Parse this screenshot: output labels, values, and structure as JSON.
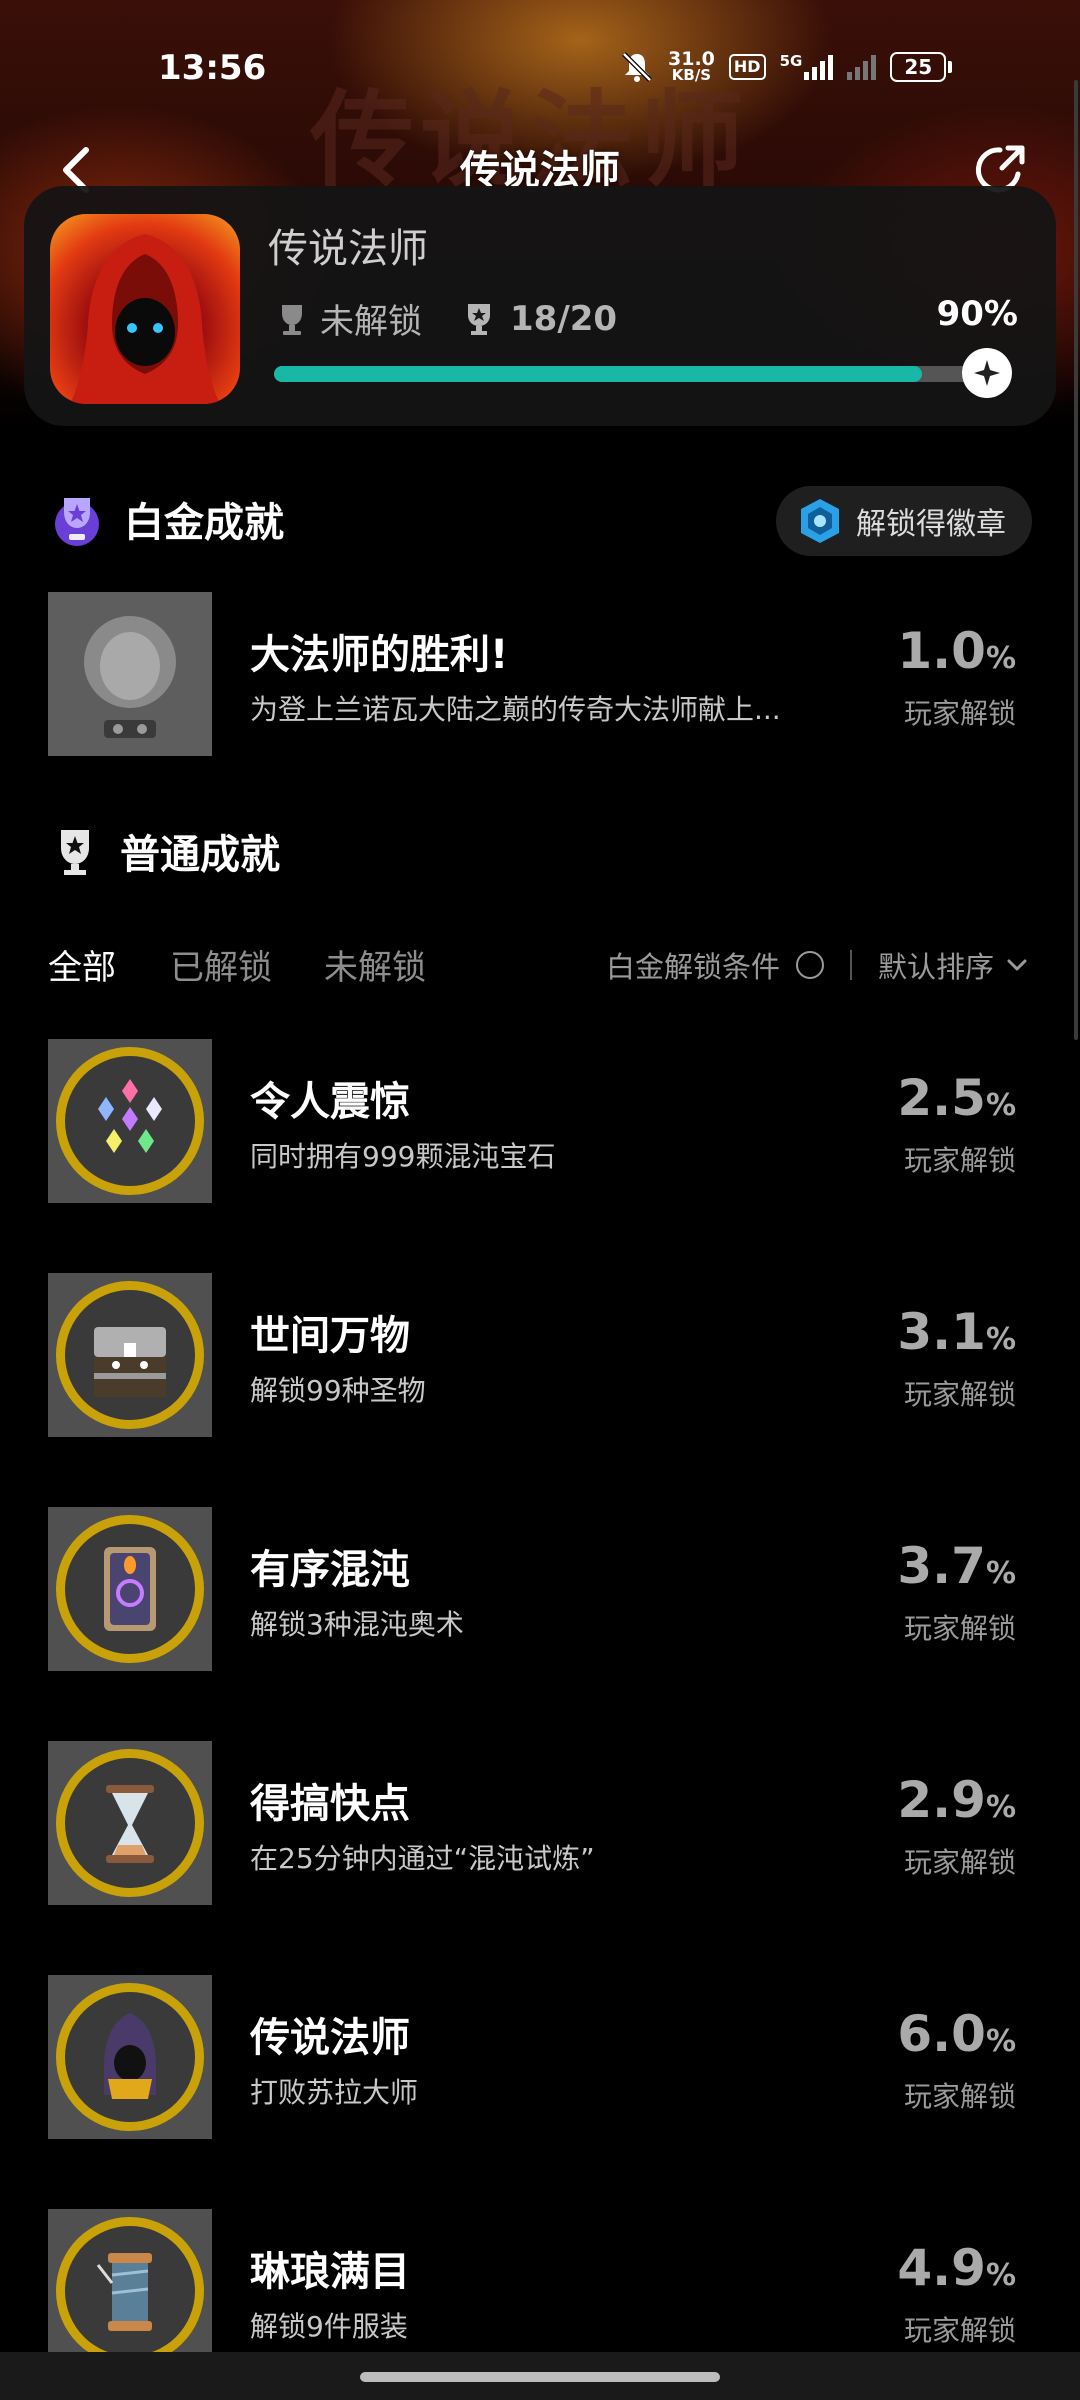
{
  "status_bar": {
    "time": "13:56",
    "net_speed_value": "31.0",
    "net_speed_unit": "KB/S",
    "hd_label": "HD",
    "network_label": "5G",
    "battery": "25"
  },
  "nav": {
    "title": "传说法师",
    "banner_text": "传说法师"
  },
  "game": {
    "name": "传说法师",
    "platinum_status": "未解锁",
    "progress_text": "18/20",
    "percent_label": "90%",
    "progress_fraction": 0.9
  },
  "platinum_section": {
    "title": "白金成就",
    "unlock_badge_label": "解锁得徽章",
    "achievement": {
      "title": "大法师的胜利!",
      "desc": "为登上兰诺瓦大陆之巅的传奇大法师献上...",
      "pct": "1.0",
      "pct_unit": "%",
      "pct_label": "玩家解锁"
    }
  },
  "normal_section": {
    "title": "普通成就"
  },
  "filter": {
    "tabs": [
      "全部",
      "已解锁",
      "未解锁"
    ],
    "platinum_condition_label": "白金解锁条件",
    "sort_label": "默认排序"
  },
  "achievements": [
    {
      "title": "令人震惊",
      "desc": "同时拥有999颗混沌宝石",
      "pct": "2.5",
      "pct_unit": "%",
      "pct_label": "玩家解锁",
      "icon": "gems-icon"
    },
    {
      "title": "世间万物",
      "desc": "解锁99种圣物",
      "pct": "3.1",
      "pct_unit": "%",
      "pct_label": "玩家解锁",
      "icon": "chest-icon"
    },
    {
      "title": "有序混沌",
      "desc": "解锁3种混沌奥术",
      "pct": "3.7",
      "pct_unit": "%",
      "pct_label": "玩家解锁",
      "icon": "arcana-card-icon"
    },
    {
      "title": "得搞快点",
      "desc": "在25分钟内通过“混沌试炼”",
      "pct": "2.9",
      "pct_unit": "%",
      "pct_label": "玩家解锁",
      "icon": "hourglass-icon"
    },
    {
      "title": "传说法师",
      "desc": "打败苏拉大师",
      "pct": "6.0",
      "pct_unit": "%",
      "pct_label": "玩家解锁",
      "icon": "wizard-icon"
    },
    {
      "title": "琳琅满目",
      "desc": "解锁9件服装",
      "pct": "4.9",
      "pct_unit": "%",
      "pct_label": "玩家解锁",
      "icon": "thread-spool-icon"
    }
  ],
  "colors": {
    "progress": "#19b7a5",
    "background": "#000000",
    "gold_ring": "#c9a20a"
  }
}
